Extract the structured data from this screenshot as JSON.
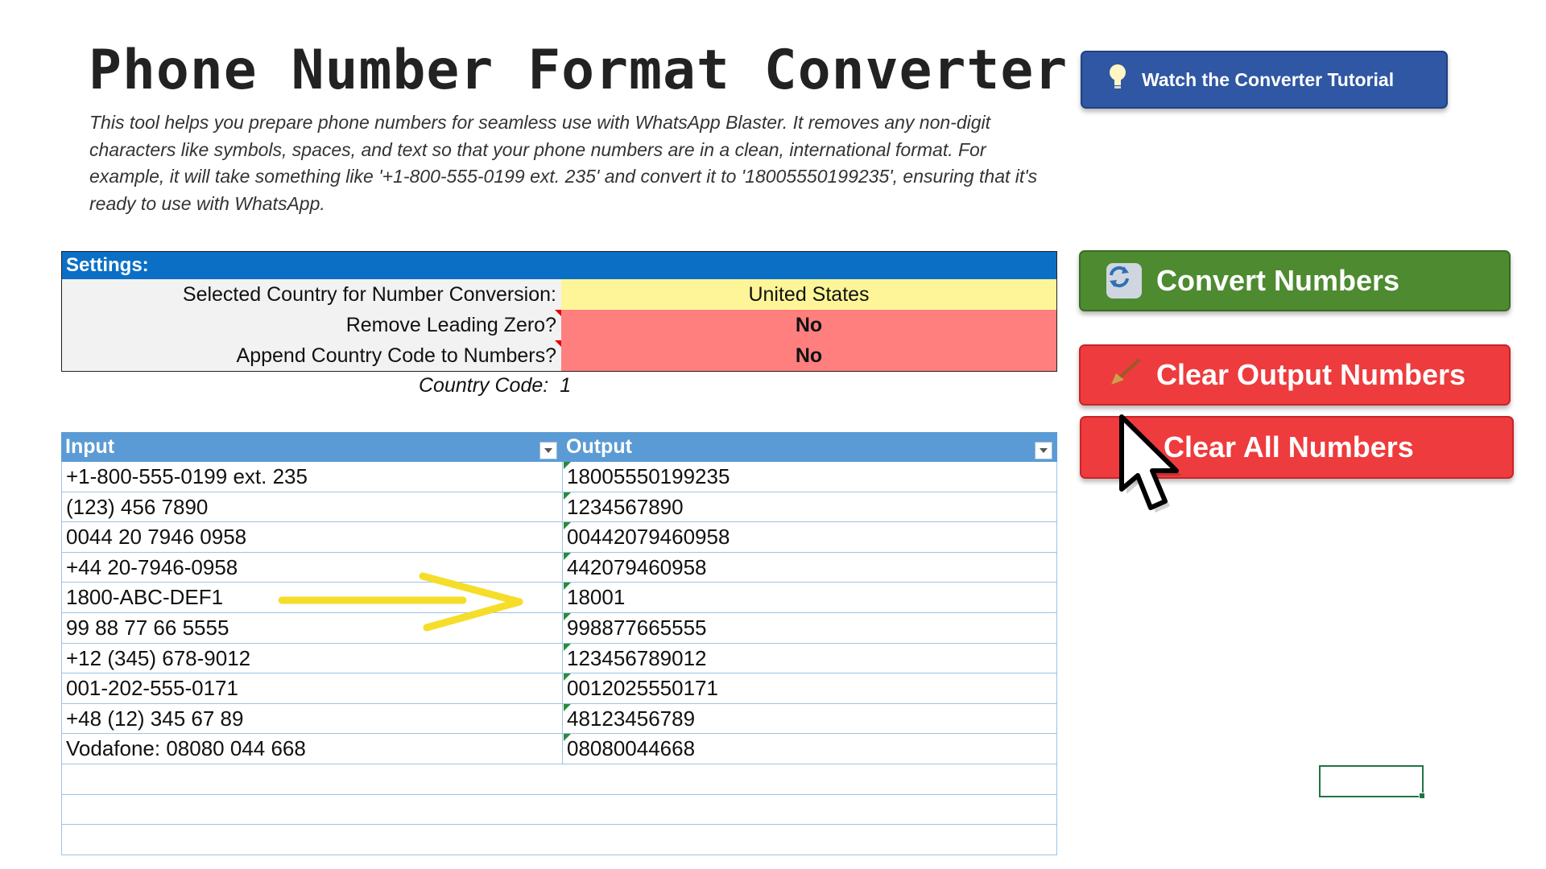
{
  "title": "Phone Number Format Converter",
  "description": "This tool helps you prepare phone numbers for seamless use with WhatsApp Blaster. It removes any non-digit characters like symbols, spaces, and text so that your phone numbers are in a clean, international format. For example, it will take something like '+1-800-555-0199 ext. 235' and convert it to '18005550199235', ensuring that it's ready to use with WhatsApp.",
  "buttons": {
    "tutorial": "Watch the Converter Tutorial",
    "convert": "Convert Numbers",
    "clear_output": "Clear Output Numbers",
    "clear_all": "Clear All Numbers"
  },
  "settings": {
    "header": "Settings:",
    "rows": [
      {
        "label": "Selected Country for Number Conversion:",
        "value": "United States"
      },
      {
        "label": "Remove Leading Zero?",
        "value": "No"
      },
      {
        "label": "Append Country Code to Numbers?",
        "value": "No"
      }
    ],
    "country_code_label": "Country Code:",
    "country_code_value": "1"
  },
  "table": {
    "headers": {
      "input": "Input",
      "output": "Output"
    },
    "rows": [
      {
        "input": "+1-800-555-0199 ext. 235",
        "output": "18005550199235"
      },
      {
        "input": "(123) 456 7890",
        "output": "1234567890"
      },
      {
        "input": "0044 20 7946 0958",
        "output": "00442079460958"
      },
      {
        "input": "+44 20-7946-0958",
        "output": "442079460958"
      },
      {
        "input": "1800-ABC-DEF1",
        "output": "18001"
      },
      {
        "input": "99 88 77 66 5555",
        "output": "998877665555"
      },
      {
        "input": "+12 (345) 678-9012",
        "output": "123456789012"
      },
      {
        "input": "001-202-555-0171",
        "output": "0012025550171"
      },
      {
        "input": "+48 (12) 345 67 89",
        "output": "48123456789"
      },
      {
        "input": "Vodafone: 08080 044 668",
        "output": "08080044668"
      }
    ]
  },
  "colors": {
    "settings_header": "#0b6fc6",
    "country_cell": "#fdf597",
    "setting_no_cell": "#ff7f7f",
    "table_header": "#5b9bd5",
    "convert_button": "#4e8a30",
    "clear_button": "#ee3b3d",
    "tutorial_button": "#2f57a3"
  },
  "icons": {
    "tutorial": "lightbulb-icon",
    "convert": "refresh-icon",
    "clear_output": "broom-icon",
    "pointer": "mouse-cursor-icon",
    "annotation": "yellow-arrow"
  }
}
